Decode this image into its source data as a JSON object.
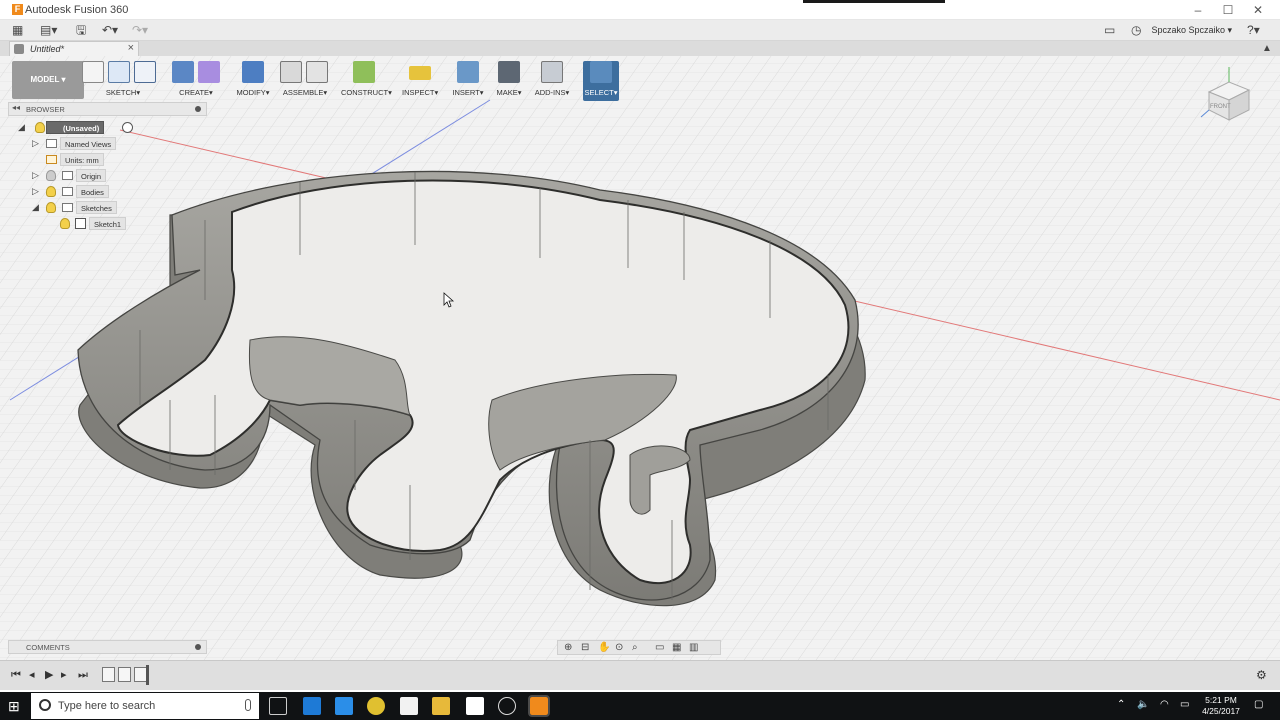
{
  "titlebar": {
    "app_title": "Autodesk Fusion 360"
  },
  "document_tab": {
    "label": "Untitled*"
  },
  "quickbar": {
    "user": "Spczako Spczaiko ▾",
    "help": "?"
  },
  "toolbar": {
    "workspace": "MODEL",
    "groups": [
      "SKETCH",
      "CREATE",
      "MODIFY",
      "ASSEMBLE",
      "CONSTRUCT",
      "INSPECT",
      "INSERT",
      "MAKE",
      "ADD-INS",
      "SELECT"
    ]
  },
  "browser": {
    "title": "BROWSER",
    "root": "(Unsaved)",
    "named_views": "Named Views",
    "units": "Units: mm",
    "origin": "Origin",
    "bodies": "Bodies",
    "sketches": "Sketches",
    "sketch1": "Sketch1"
  },
  "viewcube": {
    "face": "FRONT"
  },
  "comments": {
    "title": "COMMENTS"
  },
  "taskbar": {
    "search_placeholder": "Type here to search",
    "time": "5:21 PM",
    "date": "4/25/2017"
  },
  "colors": {
    "accent_select": "#3d6e9e",
    "model_button": "#9a9a9a",
    "body_gray": "#8a8a86"
  }
}
